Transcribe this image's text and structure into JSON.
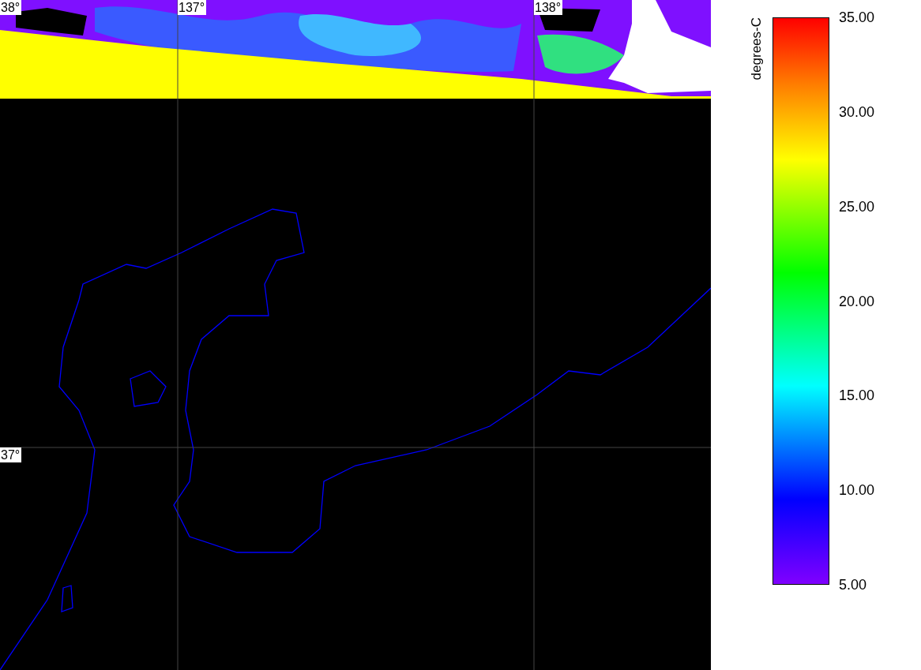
{
  "map": {
    "grid_labels": [
      {
        "text": "38°"
      },
      {
        "text": "137°"
      },
      {
        "text": "138°"
      },
      {
        "text": "37°"
      }
    ]
  },
  "colorbar": {
    "title": "degrees-C",
    "ticks": [
      "35.00",
      "30.00",
      "25.00",
      "20.00",
      "15.00",
      "10.00",
      "5.00"
    ]
  }
}
